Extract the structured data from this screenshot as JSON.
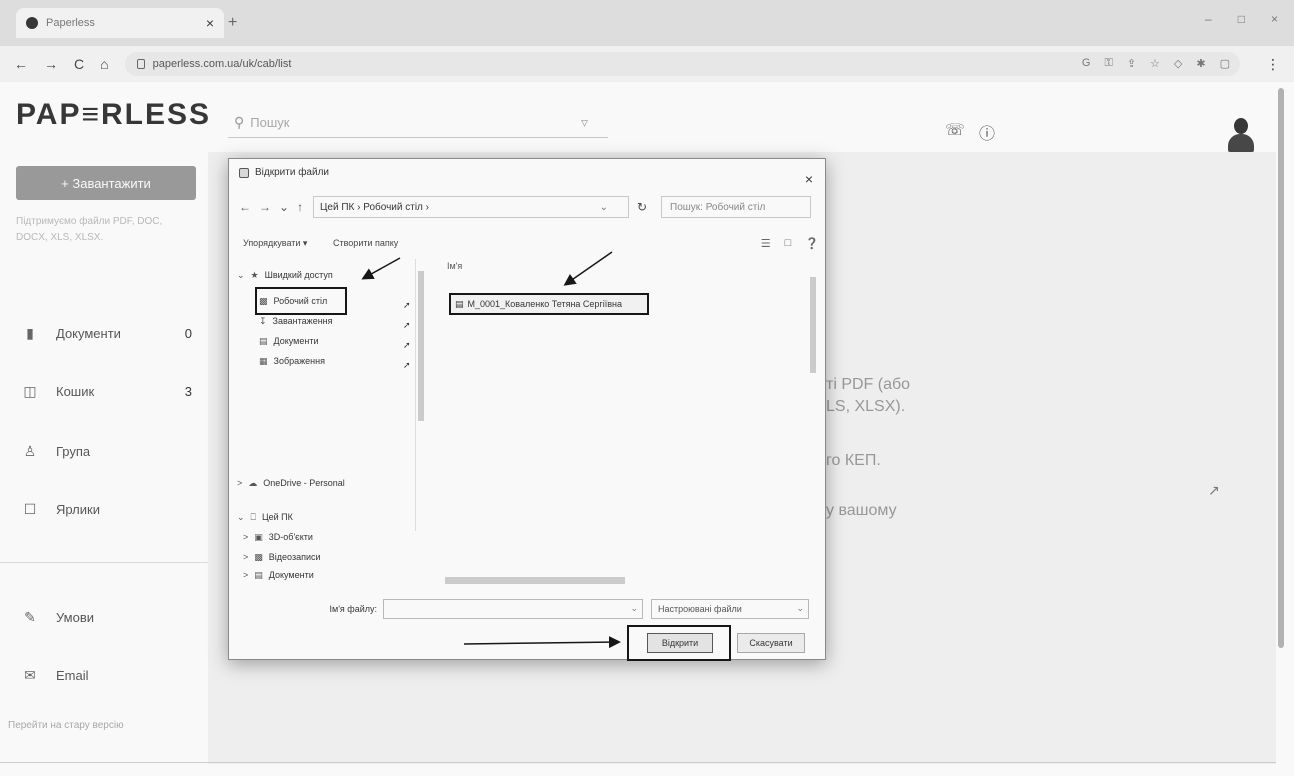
{
  "browser": {
    "tab_title": "Paperless",
    "tab_close": "×",
    "new_tab": "+",
    "url": "paperless.com.ua/uk/cab/list",
    "nav": {
      "back": "←",
      "forward": "→",
      "reload": "C",
      "home": "⌂"
    },
    "window_controls": {
      "minimize": "–",
      "maximize": "□",
      "close": "×"
    },
    "ext_icons": [
      "G",
      "⚿",
      "⇪",
      "☆",
      "◇",
      "✱",
      "▢",
      "⋮"
    ]
  },
  "app": {
    "logo": "PAP≡RLESS",
    "search_placeholder": "Пошук",
    "search_icon": "search-icon",
    "filter_icon": "filter-icon",
    "header_icons": [
      "support-icon",
      "help-icon"
    ],
    "upload_button": "+ Завантажити",
    "sidebar_note": "Підтримуємо файли PDF, DOC, DOCX, XLS, XLSX.",
    "nav": [
      {
        "label": "Документи",
        "count": "0",
        "icon": "document-icon"
      },
      {
        "label": "Кошик",
        "count": "3",
        "icon": "trash-icon"
      },
      {
        "label": "Група",
        "count": "",
        "icon": "group-icon"
      },
      {
        "label": "Ярлики",
        "count": "",
        "icon": "label-icon"
      }
    ],
    "footer_nav": [
      {
        "label": "Умови",
        "icon": "conditions-icon"
      },
      {
        "label": "Email",
        "icon": "email-icon"
      }
    ],
    "old_version_link": "Перейти на стару версію"
  },
  "background_text": {
    "line1": "ті PDF (або",
    "line2": "LS, XLSX).",
    "line3": "го КЕП.",
    "line4": "у вашому"
  },
  "dialog": {
    "title": "Відкрити файли",
    "close": "×",
    "breadcrumb": "Цей ПК › Робочий стіл ›",
    "refresh": "↻",
    "search_placeholder": "Пошук: Робочий стіл",
    "toolbar": {
      "organize": "Упорядкувати ▾",
      "new_folder": "Створити папку"
    },
    "tree": [
      {
        "label": "Швидкий доступ",
        "expander": "⌄",
        "icon": "star-icon"
      },
      {
        "label": "Робочий стіл",
        "expander": "",
        "icon": "desktop-icon",
        "pinned": true
      },
      {
        "label": "Завантаження",
        "expander": "",
        "icon": "download-icon",
        "pinned": true
      },
      {
        "label": "Документи",
        "expander": "",
        "icon": "documents-icon",
        "pinned": true
      },
      {
        "label": "Зображення",
        "expander": "",
        "icon": "images-icon",
        "pinned": true
      },
      {
        "label": "OneDrive - Personal",
        "expander": ">",
        "icon": "cloud-icon"
      },
      {
        "label": "Цей ПК",
        "expander": "⌄",
        "icon": "computer-icon"
      },
      {
        "label": "3D-об'єкти",
        "expander": ">",
        "icon": "cube-icon"
      },
      {
        "label": "Відеозаписи",
        "expander": ">",
        "icon": "video-icon"
      },
      {
        "label": "Документи",
        "expander": ">",
        "icon": "documents-icon"
      }
    ],
    "column_header": "Ім'я",
    "selected_file": "M_0001_Коваленко Тетяна Сергіївна",
    "file_name_label": "Ім'я файлу:",
    "file_name_value": "",
    "file_type": "Настроювані файли",
    "open_button": "Відкрити",
    "cancel_button": "Скасувати"
  }
}
